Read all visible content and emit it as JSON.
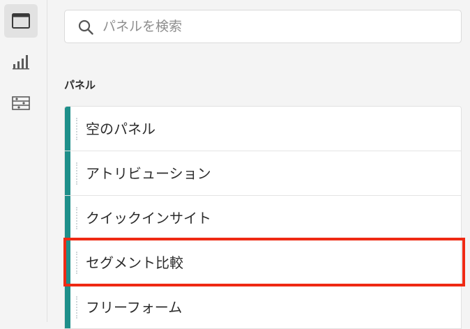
{
  "rail": {
    "items": [
      {
        "icon": "panel-icon",
        "active": true
      },
      {
        "icon": "bar-chart-icon",
        "active": false
      },
      {
        "icon": "components-icon",
        "active": false
      }
    ]
  },
  "search": {
    "placeholder": "パネルを検索",
    "value": ""
  },
  "section_title": "パネル",
  "panels": [
    {
      "label": "空のパネル"
    },
    {
      "label": "アトリビューション"
    },
    {
      "label": "クイックインサイト"
    },
    {
      "label": "セグメント比較"
    },
    {
      "label": "フリーフォーム"
    }
  ],
  "colors": {
    "panel_accent": "#1e8f8a",
    "highlight": "#ef2a14"
  }
}
